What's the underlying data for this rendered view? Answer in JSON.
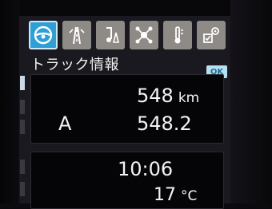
{
  "tabs": [
    {
      "name": "steering-wheel-icon",
      "active": true
    },
    {
      "name": "road-icon",
      "active": false
    },
    {
      "name": "music-note-icon",
      "active": false
    },
    {
      "name": "network-icon",
      "active": false
    },
    {
      "name": "thermometer-icon",
      "active": false
    },
    {
      "name": "settings-icon",
      "active": false
    }
  ],
  "header": {
    "title": "トラック情報",
    "ok_label": "OK"
  },
  "trip": {
    "distance_value": "548",
    "distance_unit": "km",
    "trip_label": "A",
    "trip_value": "548.2"
  },
  "status": {
    "time": "10:06",
    "temperature_value": "17",
    "temperature_unit": "°C"
  },
  "colors": {
    "active_tab": "#2f9fd6",
    "inactive_tab": "#8e8a86",
    "ok_badge": "#b7e0f2"
  }
}
